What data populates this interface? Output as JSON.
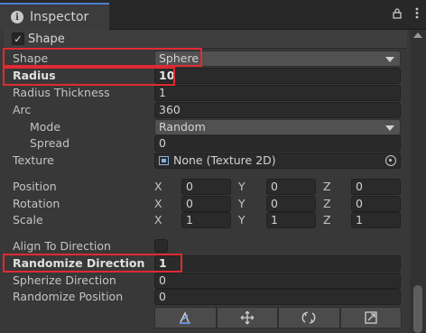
{
  "window": {
    "tab_title": "Inspector",
    "tab_icon": "info-icon",
    "lock_icon": "lock-icon",
    "menu_icon": "kebab-menu-icon"
  },
  "section": {
    "title": "Shape",
    "checked": true
  },
  "fields": {
    "shape": {
      "label": "Shape",
      "value": "Sphere"
    },
    "radius": {
      "label": "Radius",
      "value": "10"
    },
    "radius_thickness": {
      "label": "Radius Thickness",
      "value": "1"
    },
    "arc": {
      "label": "Arc",
      "value": "360"
    },
    "mode": {
      "label": "Mode",
      "value": "Random"
    },
    "spread": {
      "label": "Spread",
      "value": "0"
    },
    "texture": {
      "label": "Texture",
      "value": "None (Texture 2D)"
    },
    "position": {
      "label": "Position",
      "x_label": "X",
      "y_label": "Y",
      "z_label": "Z",
      "x": "0",
      "y": "0",
      "z": "0"
    },
    "rotation": {
      "label": "Rotation",
      "x_label": "X",
      "y_label": "Y",
      "z_label": "Z",
      "x": "0",
      "y": "0",
      "z": "0"
    },
    "scale": {
      "label": "Scale",
      "x_label": "X",
      "y_label": "Y",
      "z_label": "Z",
      "x": "1",
      "y": "1",
      "z": "1"
    },
    "align_to_direction": {
      "label": "Align To Direction",
      "checked": false
    },
    "randomize_direction": {
      "label": "Randomize Direction",
      "value": "1"
    },
    "spherize_direction": {
      "label": "Spherize Direction",
      "value": "0"
    },
    "randomize_position": {
      "label": "Randomize Position",
      "value": "0"
    }
  },
  "toolbar": {
    "buttons": [
      "edit-shape-icon",
      "move-icon",
      "rotate-icon",
      "scale-icon"
    ]
  },
  "colors": {
    "highlight": "#e02a33",
    "tab_accent": "#4c7fd0"
  }
}
